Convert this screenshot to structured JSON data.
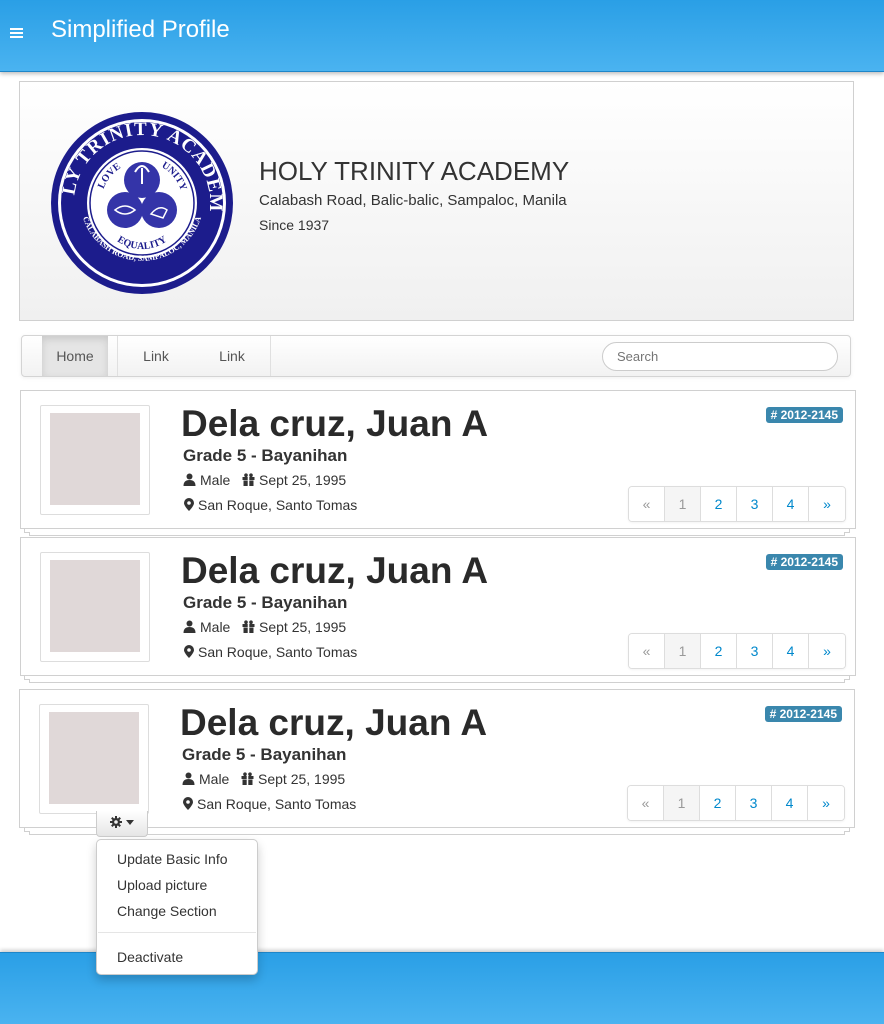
{
  "app": {
    "title": "Simplified Profile"
  },
  "school": {
    "name": "HOLY TRINITY ACADEMY",
    "address": "Calabash Road, Balic-balic, Sampaloc, Manila",
    "since": "Since 1937",
    "logo": {
      "ring_top": "HOLY TRINITY ACADEMY",
      "ring_bottom": "CALABASH ROAD, SAMPALOC, MANILA",
      "inner_love": "LOVE",
      "inner_unity": "UNITY",
      "inner_equality": "EQUALITY",
      "color": "#1c1c8c"
    }
  },
  "nav": {
    "items": [
      {
        "label": "Home",
        "active": true
      },
      {
        "label": "Link",
        "active": false
      },
      {
        "label": "Link",
        "active": false
      }
    ],
    "search_placeholder": "Search"
  },
  "students": [
    {
      "name": "Dela cruz, Juan A",
      "grade": "Grade 5 - Bayanihan",
      "gender": "Male",
      "birthdate": "Sept 25, 1995",
      "address": "San Roque, Santo Tomas",
      "id_badge": "# 2012-2145"
    },
    {
      "name": "Dela cruz, Juan A",
      "grade": "Grade 5 - Bayanihan",
      "gender": "Male",
      "birthdate": "Sept 25, 1995",
      "address": "San Roque, Santo Tomas",
      "id_badge": "# 2012-2145"
    },
    {
      "name": "Dela cruz, Juan A",
      "grade": "Grade 5 - Bayanihan",
      "gender": "Male",
      "birthdate": "Sept 25, 1995",
      "address": "San Roque, Santo Tomas",
      "id_badge": "# 2012-2145"
    }
  ],
  "pager": {
    "prev": "«",
    "pages": [
      "1",
      "2",
      "3",
      "4"
    ],
    "next": "»",
    "active_page": "1"
  },
  "actions_menu": {
    "icon": "gear-icon",
    "items": [
      "Update Basic Info",
      "Upload picture",
      "Change Section"
    ],
    "danger_item": "Deactivate"
  },
  "colors": {
    "header": "#2a9fe6",
    "badge": "#3a87ad",
    "link": "#0088cc"
  }
}
